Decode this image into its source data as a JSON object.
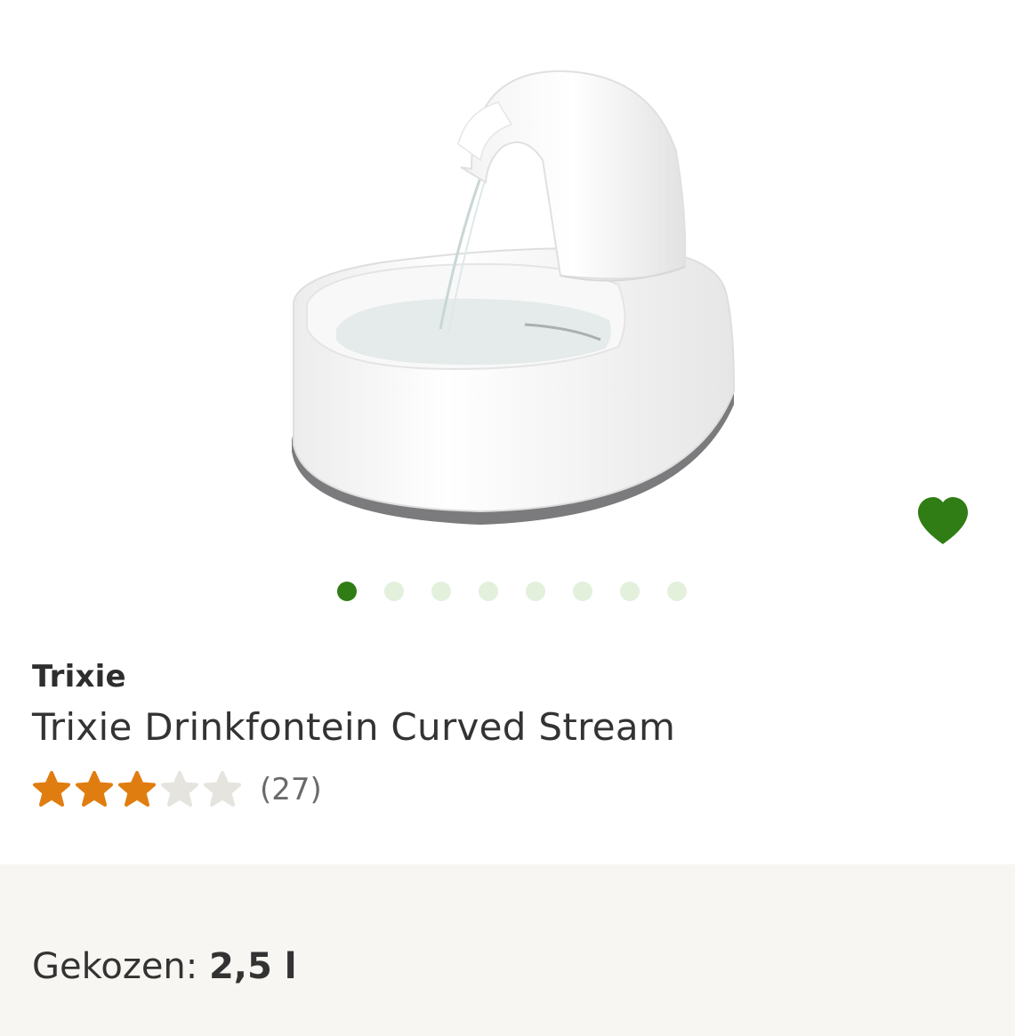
{
  "product": {
    "brand": "Trixie",
    "title": "Trixie Drinkfontein Curved Stream",
    "rating_value": 3,
    "rating_max": 5,
    "review_count": "(27)"
  },
  "gallery": {
    "image_count": 8,
    "active_index": 0
  },
  "variant": {
    "label": "Gekozen:",
    "value": "2,5 l"
  },
  "colors": {
    "accent": "#2f7d14",
    "star_filled": "#e07d10",
    "star_empty": "#e6e4df",
    "dot_inactive": "#e3f0dc",
    "panel_bg": "#f7f6f2"
  },
  "icons": {
    "favorite": "heart-icon",
    "rating": "star-icon"
  }
}
